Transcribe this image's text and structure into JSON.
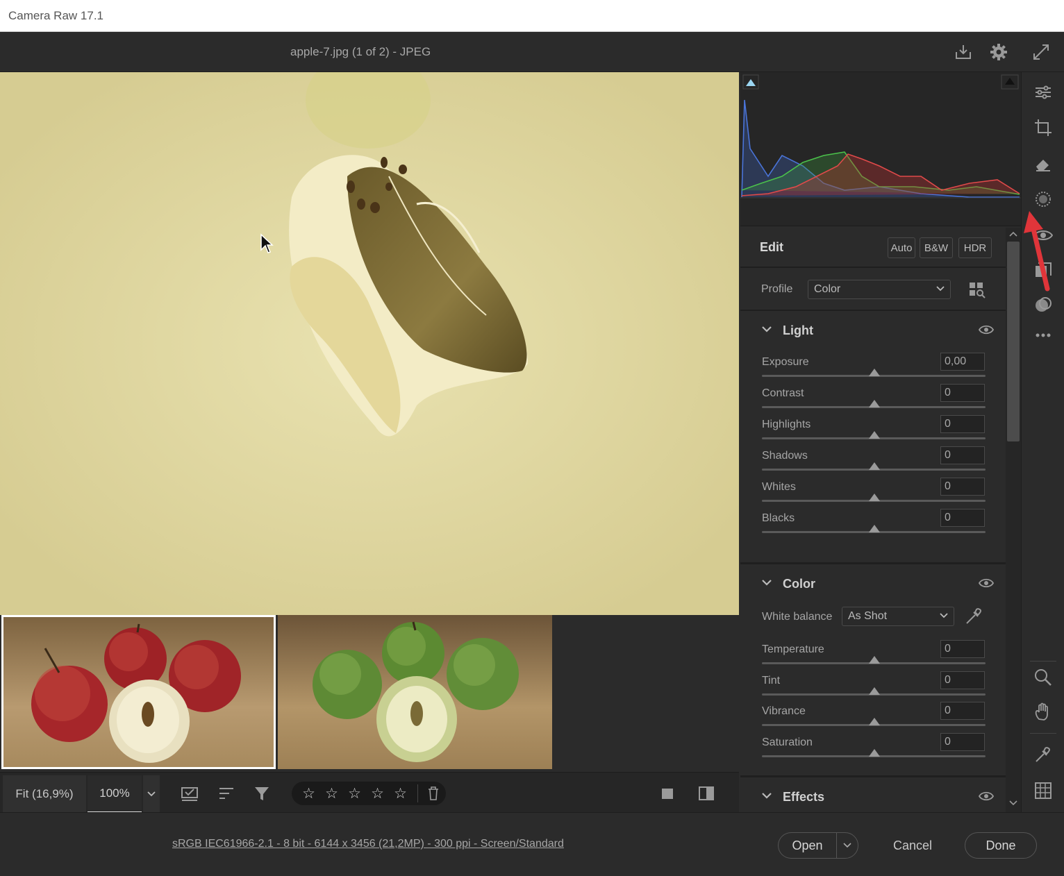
{
  "window": {
    "title": "Camera Raw 17.1"
  },
  "topbar": {
    "filename": "apple-7.jpg (1 of 2)  -  JPEG"
  },
  "bottombar": {
    "zoom_fit": "Fit (16,9%)",
    "zoom_100": "100%",
    "stars": [
      "☆",
      "☆",
      "☆",
      "☆",
      "☆"
    ]
  },
  "footer": {
    "info": "sRGB IEC61966-2.1 - 8 bit - 6144 x 3456 (21,2MP) - 300 ppi - Screen/Standard",
    "open": "Open",
    "cancel": "Cancel",
    "done": "Done"
  },
  "edit": {
    "title": "Edit",
    "auto": "Auto",
    "bw": "B&W",
    "hdr": "HDR",
    "profile_label": "Profile",
    "profile_value": "Color"
  },
  "light": {
    "title": "Light",
    "sliders": [
      {
        "label": "Exposure",
        "value": "0,00"
      },
      {
        "label": "Contrast",
        "value": "0"
      },
      {
        "label": "Highlights",
        "value": "0"
      },
      {
        "label": "Shadows",
        "value": "0"
      },
      {
        "label": "Whites",
        "value": "0"
      },
      {
        "label": "Blacks",
        "value": "0"
      }
    ]
  },
  "color": {
    "title": "Color",
    "wb_label": "White balance",
    "wb_value": "As Shot",
    "sliders": [
      {
        "label": "Temperature",
        "value": "0"
      },
      {
        "label": "Tint",
        "value": "0"
      },
      {
        "label": "Vibrance",
        "value": "0"
      },
      {
        "label": "Saturation",
        "value": "0"
      }
    ]
  },
  "effects": {
    "title": "Effects"
  },
  "colors": {
    "accent": "#e0353a",
    "panel_bg": "#2b2b2b",
    "titlebar_bg": "#ffffff"
  }
}
